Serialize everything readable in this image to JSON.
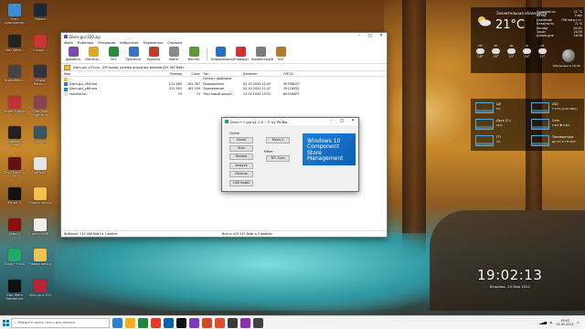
{
  "desktop": {
    "icons": [
      {
        "label": "Этот компьютер",
        "color": "#3a8fd6"
      },
      {
        "label": "Steam",
        "color": "#1b2838"
      },
      {
        "label": "Star Wars...",
        "color": "#222"
      },
      {
        "label": "Corsair...",
        "color": "#c33"
      },
      {
        "label": "Battlefield...",
        "color": "#444"
      },
      {
        "label": "Ghost Recon...",
        "color": "#334"
      },
      {
        "label": "Street Fighter V",
        "color": "#b33"
      },
      {
        "label": "Elite Beat Fighter V",
        "color": "#845"
      },
      {
        "label": "Assassin's Creed",
        "color": "#222"
      },
      {
        "label": "Vikings",
        "color": "#356"
      },
      {
        "label": "Devil May Cry 5",
        "color": "#611"
      },
      {
        "label": "AdRep...",
        "color": "#e4e4e4"
      },
      {
        "label": "Portal 2",
        "color": "#111"
      },
      {
        "label": "Новая папка",
        "color": "#f2c24c"
      },
      {
        "label": "Dota 2",
        "color": "#8a1010"
      },
      {
        "label": "шал 1968",
        "color": "#eee"
      },
      {
        "label": "Dism++x64",
        "color": "#2a6"
      },
      {
        "label": "Новая папка",
        "color": "#f2c24c"
      },
      {
        "label": "Star Wars Battlefront",
        "color": "#111"
      },
      {
        "label": "dism-gui-120",
        "color": "#b23"
      }
    ]
  },
  "winrar": {
    "title": "Dism-gui-120.zip",
    "menu": [
      "Файл",
      "Команды",
      "Операции",
      "Избранное",
      "Параметры",
      "Справка"
    ],
    "toolbar": [
      {
        "label": "Добавить",
        "color": "#7a4ab0"
      },
      {
        "label": "Извлечь...",
        "color": "#d9a830"
      },
      {
        "label": "Тест",
        "color": "#2c8a3c"
      },
      {
        "label": "Просмотр",
        "color": "#3a73c4"
      },
      {
        "label": "Удалить",
        "color": "#c23b2b"
      },
      {
        "label": "Найти",
        "color": "#8a8a8a"
      },
      {
        "label": "Мастер",
        "color": "#5a9a3a"
      },
      {
        "label": "Информация",
        "color": "#2a6fc4"
      },
      {
        "label": "Антивирус",
        "color": "#cc3333"
      },
      {
        "label": "Комментарий",
        "color": "#7b7b7b"
      },
      {
        "label": "SFX",
        "color": "#b07a30"
      }
    ],
    "address": "Dism-gui-120.zip - ZIP архив, размер исходных файлов 425 567 байт",
    "columns": [
      "Имя",
      "Размер",
      "Сжат",
      "Тип",
      "Изменён",
      "CRC32"
    ],
    "rows": [
      {
        "name": "..",
        "size": "",
        "packed": "",
        "type": "Папка с файлами",
        "modified": "",
        "crc": "",
        "icon": "#f2c24c"
      },
      {
        "name": "Dism-gui_v64.exe",
        "size": "212 480",
        "packed": "181 087",
        "type": "Приложение",
        "modified": "02.10.2020 11:47",
        "crc": "5E7B8D37",
        "icon": "#3c7ab8"
      },
      {
        "name": "Dism-gui_v86.exe",
        "size": "212 992",
        "packed": "181 199",
        "type": "Приложение",
        "modified": "02.10.2020 11:47",
        "crc": "3911B520",
        "icon": "#3c7ab8"
      },
      {
        "name": "readme.txt",
        "size": "75",
        "packed": "75",
        "type": "Текстовый докум...",
        "modified": "12.05.2020 15:52",
        "crc": "BE149AFC",
        "icon": "#ddd"
      }
    ],
    "status_left": "Выбрано: 212 480 байт в 1 файле",
    "status_right": "Всего: 425 547 байт в 3 файлах"
  },
  "dism": {
    "title": "Dism++ gui v1.2.0 - © by PinWa",
    "online_label": "Online",
    "offline_label": "Other",
    "buttons_left": [
      "Check",
      "Scan",
      "Restore",
      "Analyze",
      "Cleanup",
      "CAB Install"
    ],
    "menu_button": "Menu 2",
    "sfc_button": "SFC Scan",
    "banner": "Windows 10 Component Store Management"
  },
  "weather": {
    "city": "Значительная облачность",
    "temp": "21°C",
    "details": [
      [
        "Ощущается",
        "21 °C"
      ],
      [
        "Ветер",
        "3 м/с"
      ],
      [
        "Давление",
        "756 мм рт.ст."
      ],
      [
        "Влажность",
        "71 %"
      ],
      [
        "Восход",
        "04:01"
      ],
      [
        "Закат",
        "20:59"
      ],
      [
        "Длина дня",
        "16:58"
      ]
    ],
    "forecast": [
      {
        "day": "пн",
        "t": "16°"
      },
      {
        "day": "вт",
        "t": "25°"
      },
      {
        "day": "ср",
        "t": "23°"
      },
      {
        "day": "чт",
        "t": "16°"
      },
      {
        "day": "пт",
        "t": "17°"
      }
    ],
    "moon": "Обновлено в 19:00"
  },
  "system": [
    {
      "label": "ЦП",
      "value": "5%"
    },
    {
      "label": "SSD",
      "value": "Т 17% (0.15 МБ/с)"
    },
    {
      "label": "Диск (C:)",
      "value": "21%"
    },
    {
      "label": "Сеть",
      "value": "0 Б/с ▼ 0 Б/с"
    },
    {
      "label": "ГП",
      "value": "1%"
    },
    {
      "label": "Температура",
      "value": "ЦП 37°C  ГП 43°C"
    }
  ],
  "clock": {
    "time": "19:02:13",
    "date": "Вторник, 25 Мая 2021"
  },
  "taskbar": {
    "search_placeholder": "Введите здесь текст для поиска",
    "apps": [
      "#2d7dd2",
      "#f2b01e",
      "#1f8a3d",
      "#e23b2a",
      "#0063b1",
      "#111",
      "#7d3ac1",
      "#d04b24",
      "#e84a2e",
      "#3b3b3b",
      "#8d2ab8",
      "#444"
    ],
    "tray_time": "19:02",
    "tray_date": "25.05.2021"
  }
}
